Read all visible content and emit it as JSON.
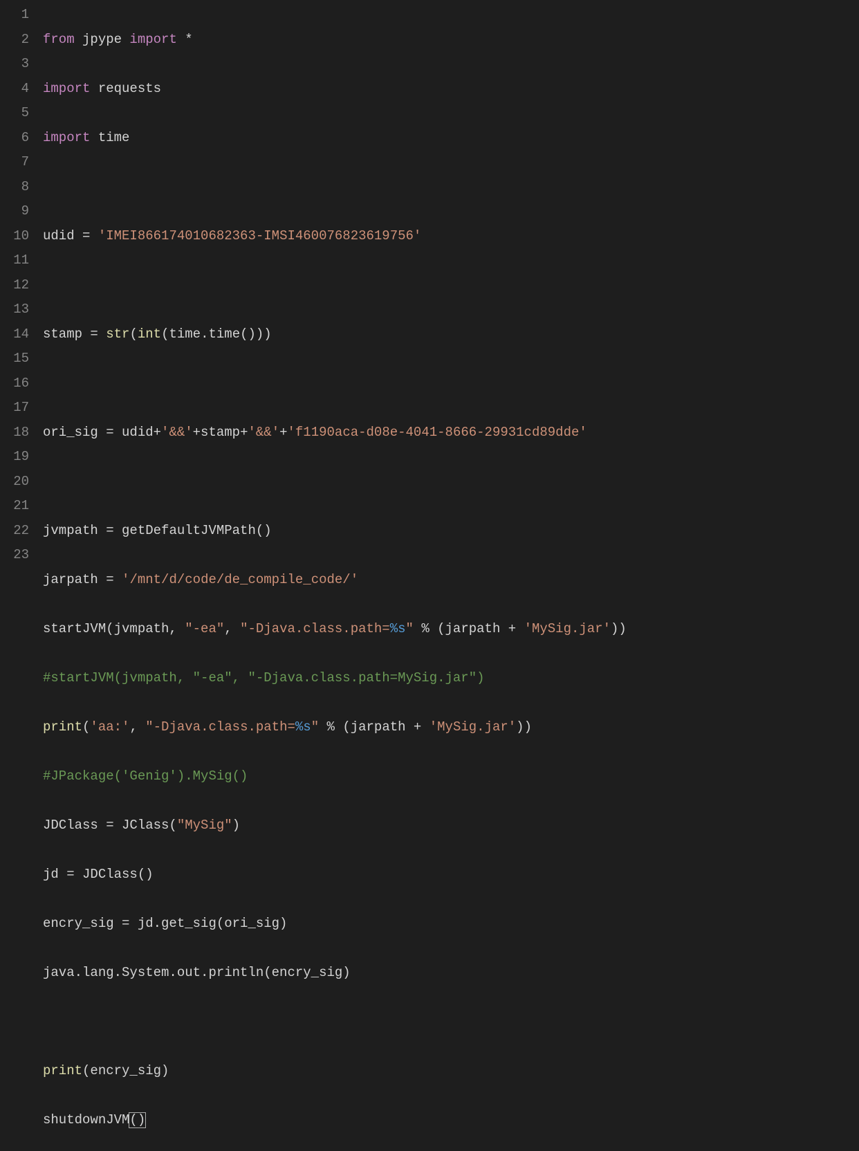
{
  "lineCount": 23,
  "colors": {
    "background": "#1e1e1e",
    "foreground": "#d4d4d4",
    "gutter": "#858585",
    "keyword": "#c586c0",
    "function": "#dcdcaa",
    "string": "#ce9178",
    "format": "#569cd6",
    "comment": "#6a9955"
  },
  "code": {
    "l1": {
      "from": "from ",
      "jpype": "jpype",
      "import": " import ",
      "star": "*"
    },
    "l2": {
      "import": "import ",
      "mod": "requests"
    },
    "l3": {
      "import": "import ",
      "mod": "time"
    },
    "l5": {
      "var": "udid",
      "eq": " = ",
      "str": "'IMEI866174010682363-IMSI460076823619756'"
    },
    "l7": {
      "var": "stamp",
      "eq": " = ",
      "strfn": "str",
      "op1": "(",
      "intfn": "int",
      "op2": "(time.time()))"
    },
    "l9": {
      "var": "ori_sig",
      "eq": " = udid+",
      "s1": "'&&'",
      "p1": "+stamp+",
      "s2": "'&&'",
      "p2": "+",
      "s3": "'f1190aca-d08e-4041-8666-29931cd89dde'"
    },
    "l11": {
      "var": "jvmpath",
      "eq": " = getDefaultJVMPath()"
    },
    "l12": {
      "var": "jarpath",
      "eq": " = ",
      "str": "'/mnt/d/code/de_compile_code/'"
    },
    "l13": {
      "fn": "startJVM(jvmpath, ",
      "s1": "\"-ea\"",
      "c1": ", ",
      "s2a": "\"-Djava.class.path=",
      "fmt": "%s",
      "s2b": "\"",
      "mid": " % (jarpath + ",
      "s3": "'MySig.jar'",
      "end": "))"
    },
    "l14": {
      "cmt": "#startJVM(jvmpath, \"-ea\", \"-Djava.class.path=MySig.jar\")"
    },
    "l15": {
      "fn": "print",
      "op1": "(",
      "s1": "'aa:'",
      "c1": ", ",
      "s2a": "\"-Djava.class.path=",
      "fmt": "%s",
      "s2b": "\"",
      "mid": " % (jarpath + ",
      "s3": "'MySig.jar'",
      "end": "))"
    },
    "l16": {
      "cmt": "#JPackage('Genig').MySig()"
    },
    "l17": {
      "txt1": "JDClass = JClass(",
      "str": "\"MySig\"",
      "txt2": ")"
    },
    "l18": {
      "txt": "jd = JDClass()"
    },
    "l19": {
      "txt": "encry_sig = jd.get_sig(ori_sig)"
    },
    "l20": {
      "txt": "java.lang.System.out.println(encry_sig)"
    },
    "l22": {
      "fn": "print",
      "txt": "(encry_sig)"
    },
    "l23": {
      "txt1": "shutdownJVM",
      "paren1": "(",
      "paren2": ")"
    }
  }
}
